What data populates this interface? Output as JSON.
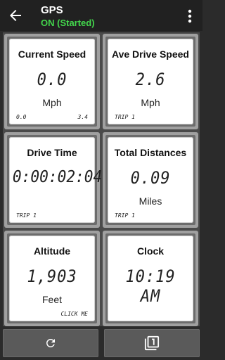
{
  "appbar": {
    "title": "GPS",
    "status": "ON (Started)",
    "status_color": "#43d64c",
    "back_icon": "arrow-left-icon",
    "menu_icon": "more-vert-icon"
  },
  "tiles": [
    {
      "label": "Current Speed",
      "value": "0.0",
      "unit": "Mph",
      "bottom_left": "0.0",
      "bottom_right": "3.4"
    },
    {
      "label": "Ave Drive Speed",
      "value": "2.6",
      "unit": "Mph",
      "bottom_left": "TRIP 1",
      "bottom_right": ""
    },
    {
      "label": "Drive Time",
      "value": "0:00:02:04",
      "unit": "",
      "bottom_left": "TRIP 1",
      "bottom_right": ""
    },
    {
      "label": "Total Distances",
      "value": "0.09",
      "unit": "Miles",
      "bottom_left": "TRIP 1",
      "bottom_right": ""
    },
    {
      "label": "Altitude",
      "value": "1,903",
      "unit": "Feet",
      "bottom_left": "",
      "bottom_right": "CLICK ME"
    },
    {
      "label": "Clock",
      "value": "10:19 AM",
      "unit": "",
      "bottom_left": "",
      "bottom_right": ""
    }
  ],
  "buttons": {
    "refresh_icon": "refresh-icon",
    "page_icon": "filter-1-icon"
  }
}
